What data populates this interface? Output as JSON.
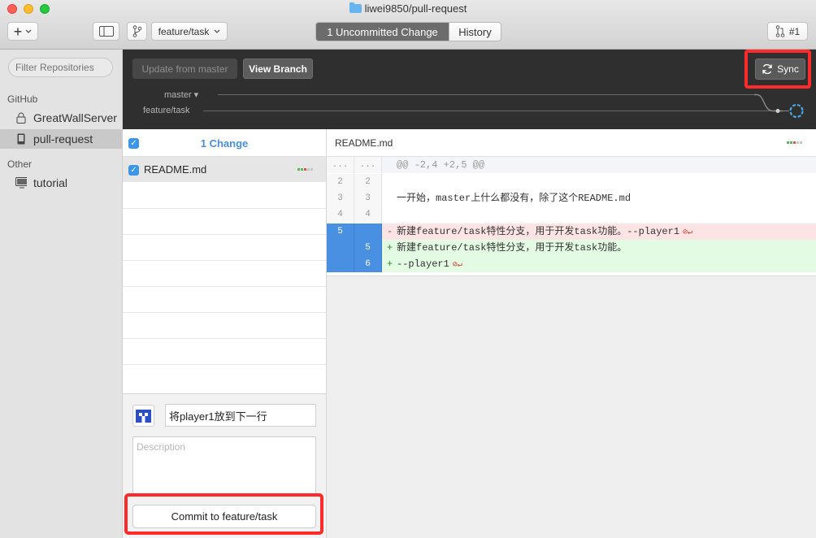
{
  "window": {
    "title": "liwei9850/pull-request"
  },
  "toolbar": {
    "add_label": "+",
    "branch_label": "feature/task",
    "tabs": [
      {
        "label": "1 Uncommitted Change"
      },
      {
        "label": "History"
      }
    ],
    "pr_label": "#1"
  },
  "sidebar": {
    "filter_placeholder": "Filter Repositories",
    "groups": [
      {
        "title": "GitHub",
        "items": [
          {
            "label": "GreatWallServer",
            "icon": "lock-icon"
          },
          {
            "label": "pull-request",
            "icon": "book-icon"
          }
        ]
      },
      {
        "title": "Other",
        "items": [
          {
            "label": "tutorial",
            "icon": "monitor-icon"
          }
        ]
      }
    ]
  },
  "branchbar": {
    "update_label": "Update from master",
    "view_label": "View Branch",
    "sync_label": "Sync",
    "master_label": "master ▾",
    "feature_label": "feature/task"
  },
  "changes": {
    "count_label": "1 Change",
    "files": [
      {
        "name": "README.md"
      }
    ]
  },
  "commit": {
    "summary": "将player1放到下一行",
    "description_placeholder": "Description",
    "button_label": "Commit to feature/task"
  },
  "diff": {
    "file": "README.md",
    "hunk": "@@ -2,4 +2,5 @@",
    "hunk_gutter": "...",
    "lines": [
      {
        "old": "2",
        "new": "2",
        "sign": " ",
        "text": ""
      },
      {
        "old": "3",
        "new": "3",
        "sign": " ",
        "text": "一开始，master上什么都没有，除了这个README.md"
      },
      {
        "old": "4",
        "new": "4",
        "sign": " ",
        "text": ""
      },
      {
        "old": "5",
        "new": "",
        "sign": "-",
        "text": "新建feature/task特性分支，用于开发task功能。--player1"
      },
      {
        "old": "",
        "new": "5",
        "sign": "+",
        "text": "新建feature/task特性分支，用于开发task功能。"
      },
      {
        "old": "",
        "new": "6",
        "sign": "+",
        "text": "--player1"
      }
    ]
  },
  "colors": {
    "accent": "#4a90e2",
    "removed": "#fde4e4",
    "added": "#e3fbe3",
    "highlight": "#ff2a2a"
  }
}
